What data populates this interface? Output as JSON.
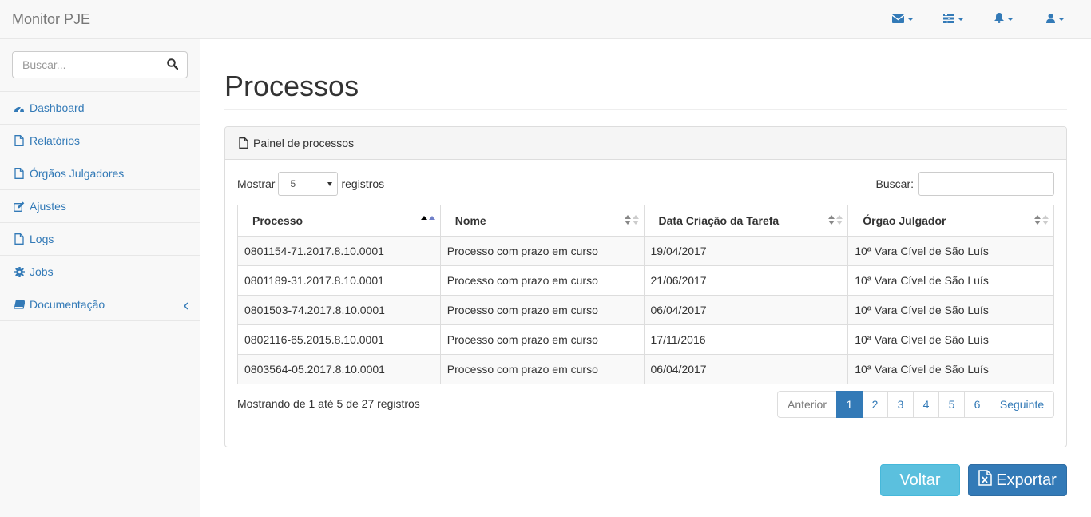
{
  "app": {
    "brand": "Monitor PJE"
  },
  "navbar": {
    "icons": [
      "envelope-icon",
      "tasks-icon",
      "bell-icon",
      "user-icon"
    ]
  },
  "sidebar": {
    "search_placeholder": "Buscar...",
    "items": [
      {
        "label": "Dashboard",
        "icon": "dashboard-icon"
      },
      {
        "label": "Relatórios",
        "icon": "file-icon"
      },
      {
        "label": "Órgãos Julgadores",
        "icon": "file-icon"
      },
      {
        "label": "Ajustes",
        "icon": "edit-icon"
      },
      {
        "label": "Logs",
        "icon": "file-icon"
      },
      {
        "label": "Jobs",
        "icon": "gear-icon"
      },
      {
        "label": "Documentação",
        "icon": "book-icon"
      }
    ]
  },
  "page": {
    "title": "Processos"
  },
  "panel": {
    "heading": "Painel de processos",
    "length_prefix": "Mostrar",
    "length_value": "5",
    "length_suffix": "registros",
    "filter_label": "Buscar:",
    "filter_value": "",
    "columns": [
      "Processo",
      "Nome",
      "Data Criação da Tarefa",
      "Órgao Julgador"
    ],
    "rows": [
      [
        "0801154-71.2017.8.10.0001",
        "Processo com prazo em curso",
        "19/04/2017",
        "10ª Vara Cível de São Luís"
      ],
      [
        "0801189-31.2017.8.10.0001",
        "Processo com prazo em curso",
        "21/06/2017",
        "10ª Vara Cível de São Luís"
      ],
      [
        "0801503-74.2017.8.10.0001",
        "Processo com prazo em curso",
        "06/04/2017",
        "10ª Vara Cível de São Luís"
      ],
      [
        "0802116-65.2015.8.10.0001",
        "Processo com prazo em curso",
        "17/11/2016",
        "10ª Vara Cível de São Luís"
      ],
      [
        "0803564-05.2017.8.10.0001",
        "Processo com prazo em curso",
        "06/04/2017",
        "10ª Vara Cível de São Luís"
      ]
    ],
    "info": "Mostrando de 1 até 5 de 27 registros",
    "pagination": {
      "previous": "Anterior",
      "pages": [
        "1",
        "2",
        "3",
        "4",
        "5",
        "6"
      ],
      "active": "1",
      "next": "Seguinte"
    }
  },
  "actions": {
    "back": "Voltar",
    "export": "Exportar"
  },
  "colors": {
    "primary": "#337ab7",
    "info": "#5bc0de",
    "navbar_bg": "#f8f8f8",
    "border": "#e7e7e7"
  }
}
